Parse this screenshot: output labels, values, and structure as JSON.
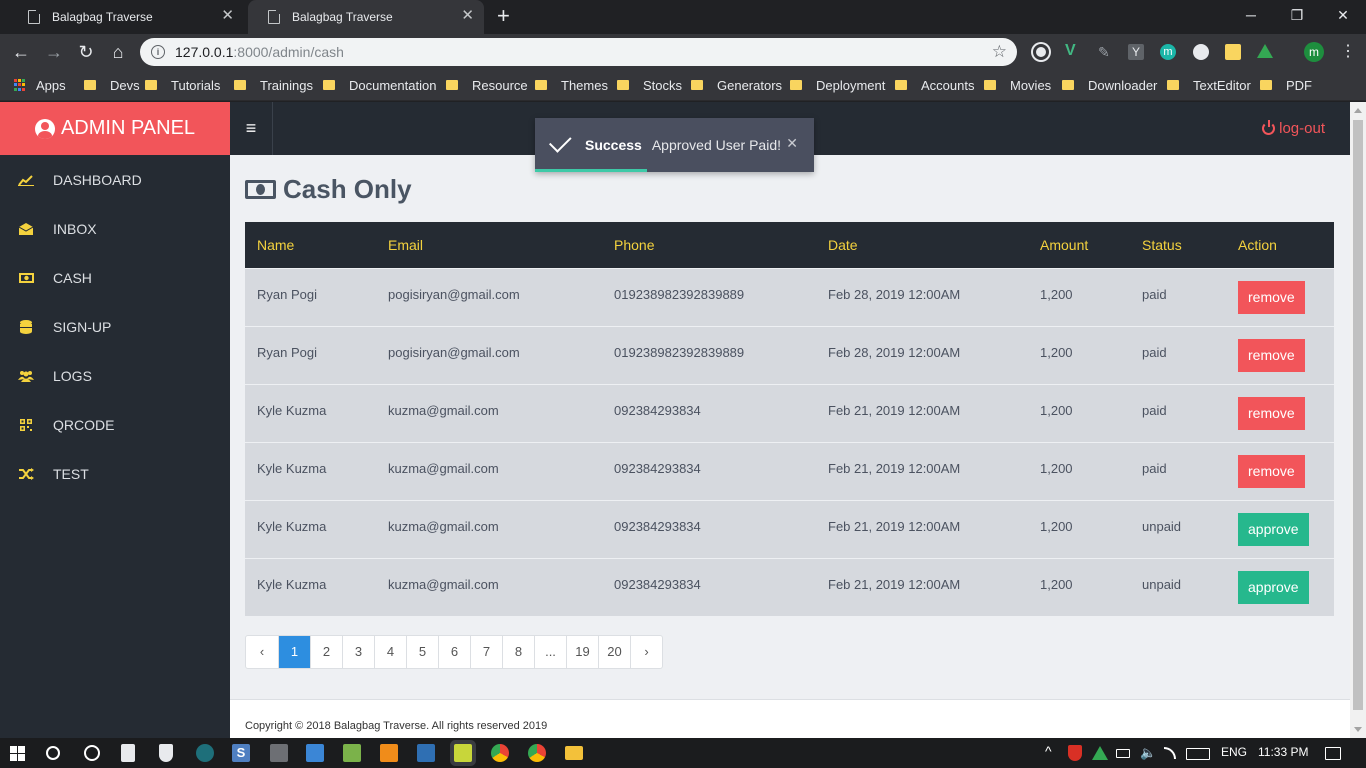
{
  "browser": {
    "tabs": [
      {
        "title": "Balagbag Traverse",
        "active": false
      },
      {
        "title": "Balagbag Traverse",
        "active": true
      }
    ],
    "url_host": "127.0.0.1",
    "url_path": ":8000/admin/cash",
    "bookmarks": [
      "Apps",
      "Devs",
      "Tutorials",
      "Trainings",
      "Documentation",
      "Resource",
      "Themes",
      "Stocks",
      "Generators",
      "Deployment",
      "Accounts",
      "Movies",
      "Downloader",
      "TextEditor",
      "PDF"
    ],
    "profile_initial": "m"
  },
  "sidebar": {
    "brand": "ADMIN PANEL",
    "items": [
      {
        "label": "DASHBOARD",
        "icon": "chart-line-icon"
      },
      {
        "label": "INBOX",
        "icon": "envelope-icon"
      },
      {
        "label": "CASH",
        "icon": "money-icon"
      },
      {
        "label": "SIGN-UP",
        "icon": "database-icon"
      },
      {
        "label": "LOGS",
        "icon": "users-icon"
      },
      {
        "label": "QRCODE",
        "icon": "qrcode-icon"
      },
      {
        "label": "TEST",
        "icon": "shuffle-icon"
      }
    ]
  },
  "topbar": {
    "logout": "log-out"
  },
  "toast": {
    "title": "Success",
    "message": "Approved User Paid!"
  },
  "page": {
    "title": "Cash Only"
  },
  "table": {
    "headers": [
      "Name",
      "Email",
      "Phone",
      "Date",
      "Amount",
      "Status",
      "Action"
    ],
    "rows": [
      {
        "name": "Ryan Pogi",
        "email": "pogisiryan@gmail.com",
        "phone": "019238982392839889",
        "date": "Feb 28, 2019 12:00AM",
        "amount": "1,200",
        "status": "paid",
        "action": "remove"
      },
      {
        "name": "Ryan Pogi",
        "email": "pogisiryan@gmail.com",
        "phone": "019238982392839889",
        "date": "Feb 28, 2019 12:00AM",
        "amount": "1,200",
        "status": "paid",
        "action": "remove"
      },
      {
        "name": "Kyle Kuzma",
        "email": "kuzma@gmail.com",
        "phone": "092384293834",
        "date": "Feb 21, 2019 12:00AM",
        "amount": "1,200",
        "status": "paid",
        "action": "remove"
      },
      {
        "name": "Kyle Kuzma",
        "email": "kuzma@gmail.com",
        "phone": "092384293834",
        "date": "Feb 21, 2019 12:00AM",
        "amount": "1,200",
        "status": "paid",
        "action": "remove"
      },
      {
        "name": "Kyle Kuzma",
        "email": "kuzma@gmail.com",
        "phone": "092384293834",
        "date": "Feb 21, 2019 12:00AM",
        "amount": "1,200",
        "status": "unpaid",
        "action": "approve"
      },
      {
        "name": "Kyle Kuzma",
        "email": "kuzma@gmail.com",
        "phone": "092384293834",
        "date": "Feb 21, 2019 12:00AM",
        "amount": "1,200",
        "status": "unpaid",
        "action": "approve"
      }
    ]
  },
  "pagination": {
    "prev": "‹",
    "pages": [
      "1",
      "2",
      "3",
      "4",
      "5",
      "6",
      "7",
      "8",
      "...",
      "19",
      "20"
    ],
    "next": "›",
    "current": "1"
  },
  "footer": {
    "text": "Copyright © 2018 Balagbag Traverse. All rights reserved 2019"
  },
  "taskbar": {
    "language": "ENG",
    "time": "11:33 PM"
  },
  "colors": {
    "accent": "#f2555a",
    "sidebar": "#252b33",
    "header_text": "#f4d23e",
    "approve": "#26b88d",
    "page_active": "#2d8ee0"
  }
}
